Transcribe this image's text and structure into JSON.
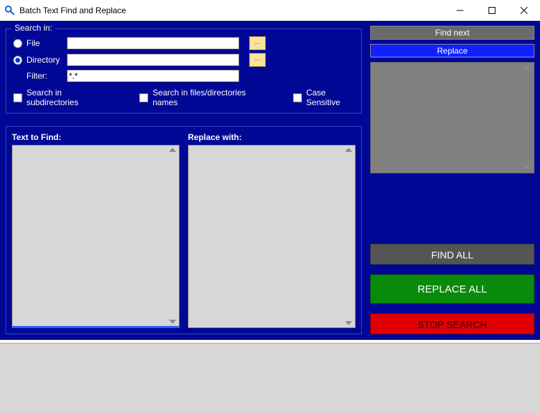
{
  "title": "Batch Text Find and Replace",
  "searchIn": {
    "legend": "Search in:",
    "fileLabel": "File",
    "fileValue": "",
    "directoryLabel": "Directory",
    "directoryValue": "",
    "filterLabel": "Filter:",
    "filterValue": "*.*",
    "browse": "...",
    "searchSubdirs": "Search in subdirectories",
    "searchNames": "Search in files/directories names",
    "caseSensitive": "Case Sensitive"
  },
  "textFind": {
    "findLabel": "Text to Find:",
    "replaceLabel": "Replace with:"
  },
  "buttons": {
    "findNext": "Find next",
    "replaceOne": "Replace",
    "findAll": "FIND ALL",
    "replaceAll": "REPLACE ALL",
    "stopSearch": "STOP SEARCH"
  }
}
